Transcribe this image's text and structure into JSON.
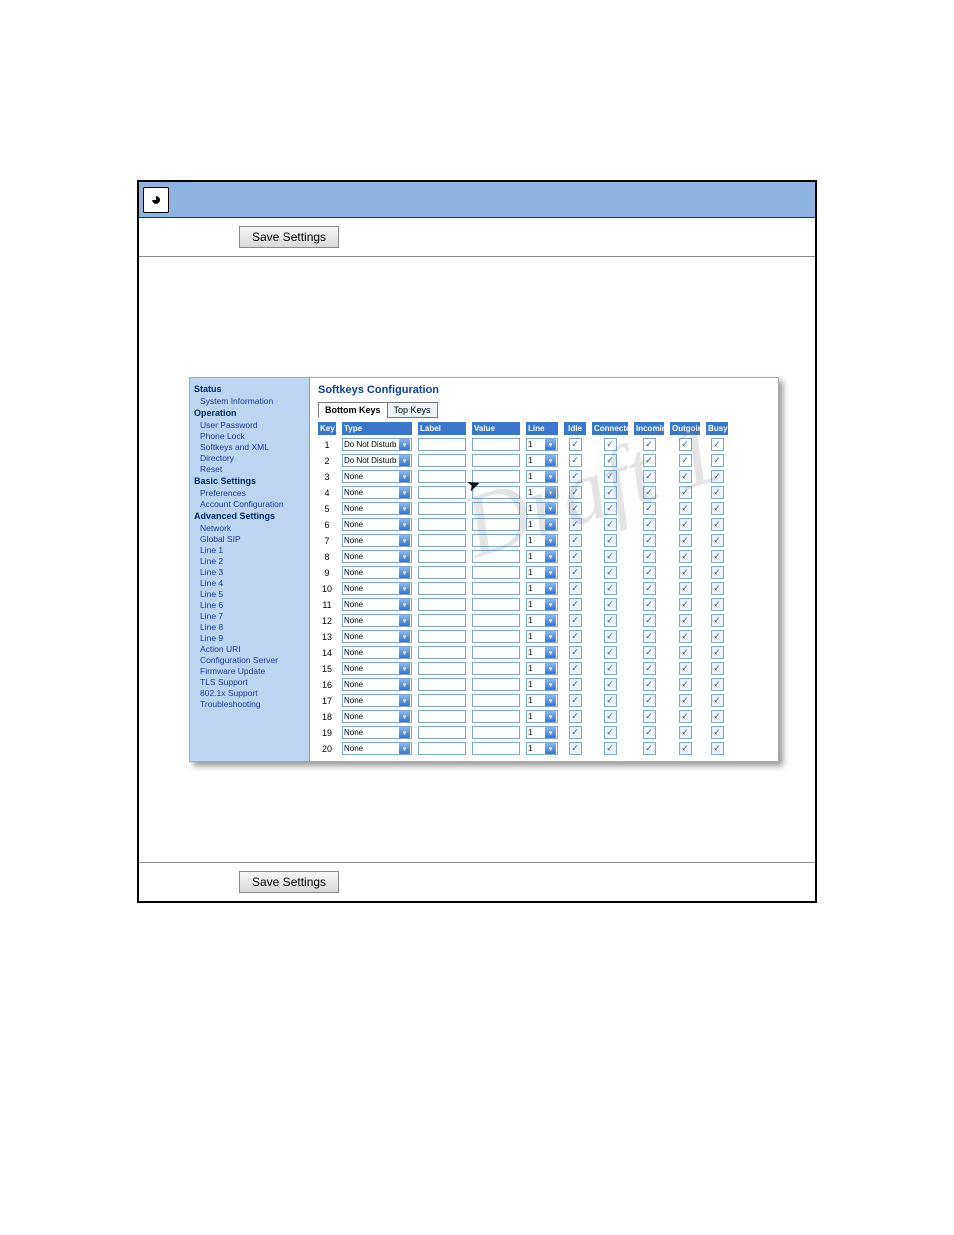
{
  "buttons": {
    "save_settings": "Save Settings"
  },
  "sidebar": {
    "status": "Status",
    "system_information": "System Information",
    "operation": "Operation",
    "user_password": "User Password",
    "phone_lock": "Phone Lock",
    "softkeys_xml": "Softkeys and XML",
    "directory": "Directory",
    "reset": "Reset",
    "basic_settings": "Basic Settings",
    "preferences": "Preferences",
    "account_configuration": "Account Configuration",
    "advanced_settings": "Advanced Settings",
    "network": "Network",
    "global_sip": "Global SIP",
    "line1": "Line 1",
    "line2": "Line 2",
    "line3": "Line 3",
    "line4": "Line 4",
    "line5": "Line 5",
    "line6": "Line 6",
    "line7": "Line 7",
    "line8": "Line 8",
    "line9": "Line 9",
    "action_uri": "Action URI",
    "configuration_server": "Configuration Server",
    "firmware_update": "Firmware Update",
    "tls_support": "TLS Support",
    "8021x": "802.1x Support",
    "troubleshooting": "Troubleshooting"
  },
  "main": {
    "title": "Softkeys Configuration",
    "tabs": {
      "bottom": "Bottom Keys",
      "top": "Top Keys"
    },
    "headers": {
      "key": "Key",
      "type": "Type",
      "label": "Label",
      "value": "Value",
      "line": "Line",
      "idle": "Idle",
      "connected": "Connected",
      "incoming": "Incoming",
      "outgoing": "Outgoing",
      "busy": "Busy"
    },
    "rows": [
      {
        "key": "1",
        "type": "Do Not Disturb",
        "line": "1",
        "active": true
      },
      {
        "key": "2",
        "type": "Do Not Disturb",
        "line": "1",
        "active": true
      },
      {
        "key": "3",
        "type": "None",
        "line": "1",
        "active": false
      },
      {
        "key": "4",
        "type": "None",
        "line": "1",
        "active": false
      },
      {
        "key": "5",
        "type": "None",
        "line": "1",
        "active": false
      },
      {
        "key": "6",
        "type": "None",
        "line": "1",
        "active": false
      },
      {
        "key": "7",
        "type": "None",
        "line": "1",
        "active": false
      },
      {
        "key": "8",
        "type": "None",
        "line": "1",
        "active": false
      },
      {
        "key": "9",
        "type": "None",
        "line": "1",
        "active": false
      },
      {
        "key": "10",
        "type": "None",
        "line": "1",
        "active": false
      },
      {
        "key": "11",
        "type": "None",
        "line": "1",
        "active": false
      },
      {
        "key": "12",
        "type": "None",
        "line": "1",
        "active": false
      },
      {
        "key": "13",
        "type": "None",
        "line": "1",
        "active": false
      },
      {
        "key": "14",
        "type": "None",
        "line": "1",
        "active": false
      },
      {
        "key": "15",
        "type": "None",
        "line": "1",
        "active": false
      },
      {
        "key": "16",
        "type": "None",
        "line": "1",
        "active": false
      },
      {
        "key": "17",
        "type": "None",
        "line": "1",
        "active": false
      },
      {
        "key": "18",
        "type": "None",
        "line": "1",
        "active": false
      },
      {
        "key": "19",
        "type": "None",
        "line": "1",
        "active": false
      },
      {
        "key": "20",
        "type": "None",
        "line": "1",
        "active": false
      }
    ]
  },
  "watermark": "Draft 1"
}
